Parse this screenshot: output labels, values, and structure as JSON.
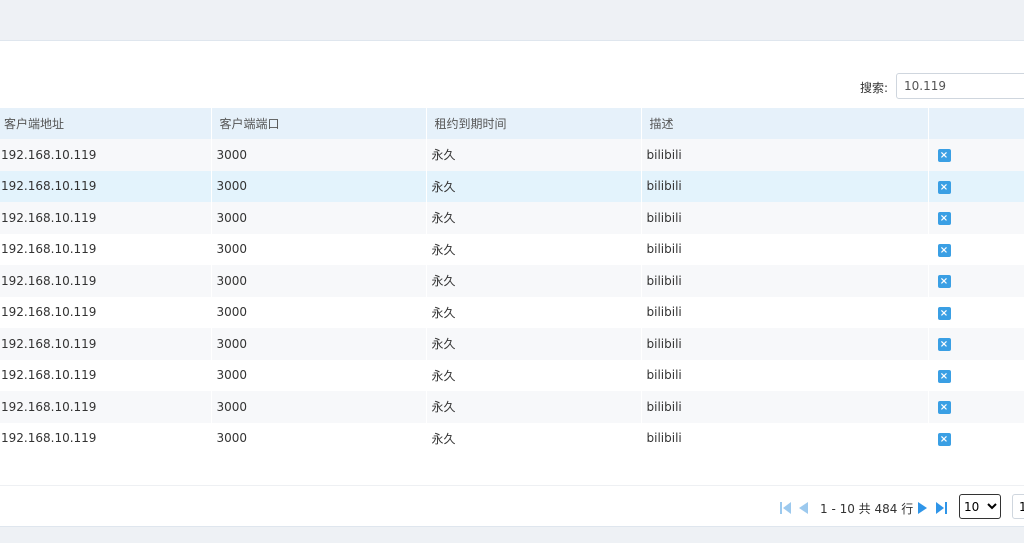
{
  "search": {
    "label": "搜索:",
    "value": "10.119"
  },
  "table": {
    "columns": [
      "客户端地址",
      "客户端端口",
      "租约到期时间",
      "描述",
      ""
    ],
    "rows": [
      {
        "ip": "192.168.10.119",
        "port": "3000",
        "expire": "永久",
        "desc": "bilibili"
      },
      {
        "ip": "192.168.10.119",
        "port": "3000",
        "expire": "永久",
        "desc": "bilibili"
      },
      {
        "ip": "192.168.10.119",
        "port": "3000",
        "expire": "永久",
        "desc": "bilibili"
      },
      {
        "ip": "192.168.10.119",
        "port": "3000",
        "expire": "永久",
        "desc": "bilibili"
      },
      {
        "ip": "192.168.10.119",
        "port": "3000",
        "expire": "永久",
        "desc": "bilibili"
      },
      {
        "ip": "192.168.10.119",
        "port": "3000",
        "expire": "永久",
        "desc": "bilibili"
      },
      {
        "ip": "192.168.10.119",
        "port": "3000",
        "expire": "永久",
        "desc": "bilibili"
      },
      {
        "ip": "192.168.10.119",
        "port": "3000",
        "expire": "永久",
        "desc": "bilibili"
      },
      {
        "ip": "192.168.10.119",
        "port": "3000",
        "expire": "永久",
        "desc": "bilibili"
      },
      {
        "ip": "192.168.10.119",
        "port": "3000",
        "expire": "永久",
        "desc": "bilibili"
      }
    ],
    "delete_icon": "delete-x-icon"
  },
  "pagination": {
    "info": "1 - 10 共 484 行",
    "page_size": "10",
    "page_size_options": [
      "10"
    ],
    "current_page": "1"
  },
  "colors": {
    "accent": "#3a9fe4",
    "header_bg": "#e6f1fa",
    "hover_row": "#e3f3fc",
    "stripe_row": "#f7f8fa"
  }
}
